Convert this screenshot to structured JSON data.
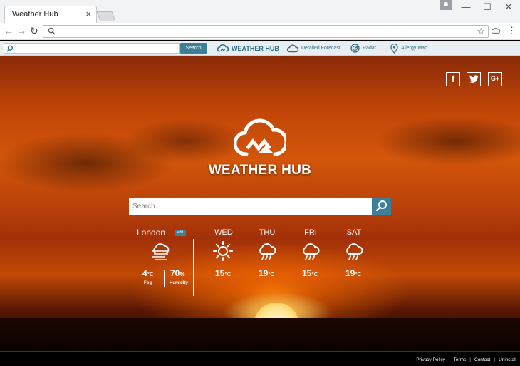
{
  "browser": {
    "tab_title": "Weather Hub",
    "tab_close": "×",
    "address_value": "",
    "star_icon": "☆",
    "menu_icon": "⋮",
    "window": {
      "minimize": "—",
      "maximize": "☐",
      "close": "✕"
    }
  },
  "extension_bar": {
    "search_value": "",
    "search_button": "Search",
    "items": [
      {
        "label": "WEATHER HUB",
        "icon": "cloud-logo-icon"
      },
      {
        "label": "Detailed Forecast",
        "icon": "cloud-icon"
      },
      {
        "label": "Radar",
        "icon": "radar-icon"
      },
      {
        "label": "Allergy Map",
        "icon": "map-pin-icon"
      }
    ]
  },
  "social": [
    {
      "label": "f",
      "icon": "facebook-icon"
    },
    {
      "label": "🐦",
      "icon": "twitter-icon"
    },
    {
      "label": "G+",
      "icon": "google-plus-icon"
    }
  ],
  "logo": {
    "text": "WEATHER HUB"
  },
  "search": {
    "placeholder": "Search..."
  },
  "current": {
    "city": "London",
    "edit_label": "edit",
    "temp": "4",
    "temp_unit": "°C",
    "condition": "Fog",
    "humidity": "70",
    "humidity_unit": "%",
    "humidity_label": "Humidity"
  },
  "forecast": [
    {
      "day": "WED",
      "temp": "15",
      "unit": "°C",
      "icon": "sunny-icon"
    },
    {
      "day": "THU",
      "temp": "19",
      "unit": "°C",
      "icon": "rain-cloud-icon"
    },
    {
      "day": "FRI",
      "temp": "15",
      "unit": "°C",
      "icon": "rain-cloud-icon"
    },
    {
      "day": "SAT",
      "temp": "19",
      "unit": "°C",
      "icon": "rain-cloud-icon"
    }
  ],
  "footer": {
    "links": [
      "Privacy Policy",
      "Terms",
      "Contact",
      "Uninstall"
    ]
  },
  "colors": {
    "accent": "#3d7f98",
    "sunset": "#c04508"
  }
}
